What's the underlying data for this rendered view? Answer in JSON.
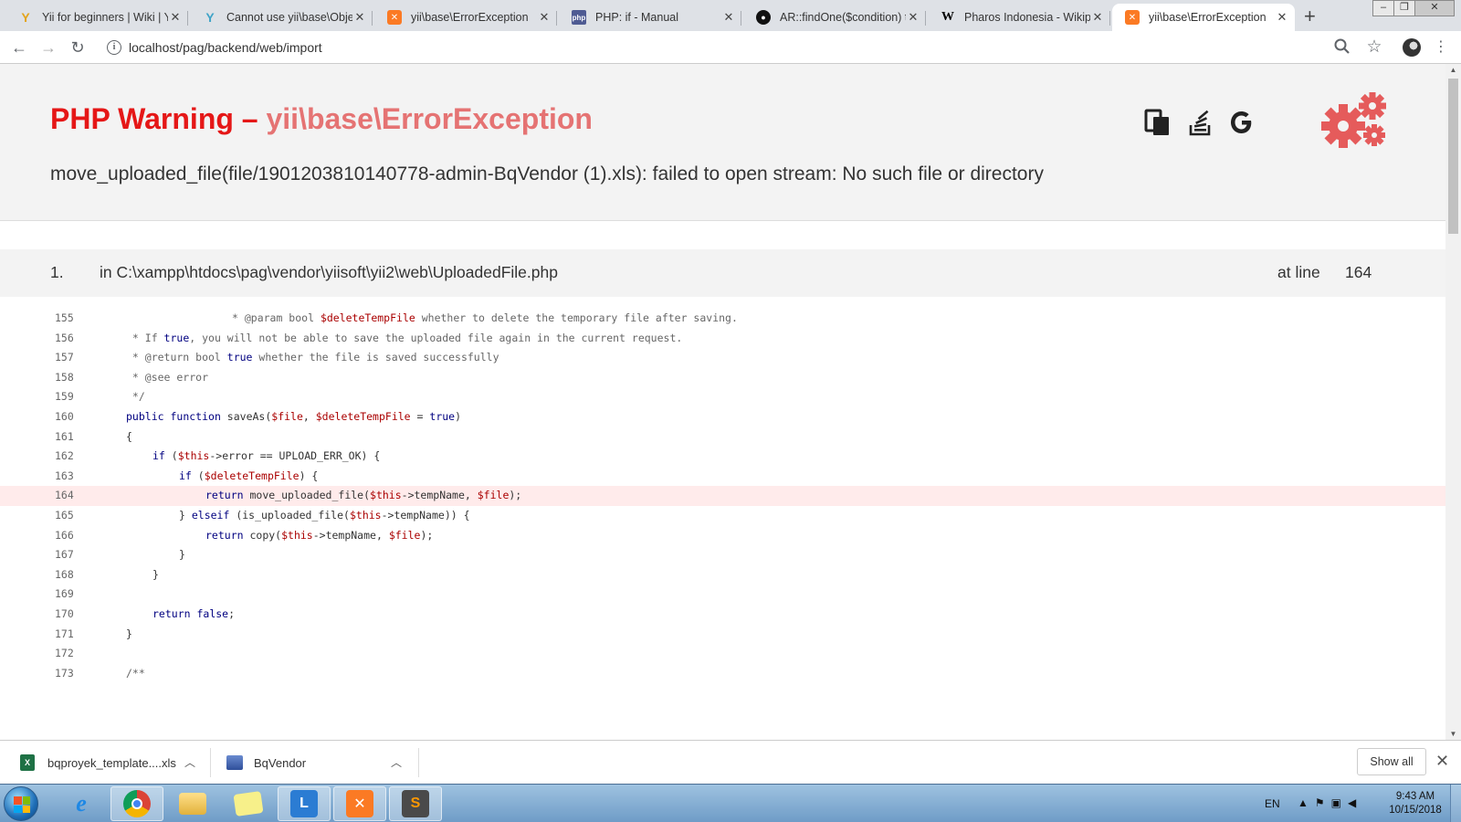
{
  "tabs": [
    {
      "title": "Yii for beginners | Wiki | Yii",
      "icon": "yii-icon",
      "active": false
    },
    {
      "title": "Cannot use yii\\base\\Object",
      "icon": "yii-icon",
      "active": false
    },
    {
      "title": "yii\\base\\ErrorException",
      "icon": "xampp-icon",
      "active": false
    },
    {
      "title": "PHP: if - Manual",
      "icon": "php-icon",
      "active": false
    },
    {
      "title": "AR::findOne($condition) to",
      "icon": "github-icon",
      "active": false
    },
    {
      "title": "Pharos Indonesia - Wikipedia",
      "icon": "wikipedia-icon",
      "active": false
    },
    {
      "title": "yii\\base\\ErrorException",
      "icon": "xampp-icon",
      "active": true
    }
  ],
  "address_bar": {
    "url": "localhost/pag/backend/web/import"
  },
  "error": {
    "type": "PHP Warning",
    "separator": "–",
    "exception": "yii\\base\\ErrorException",
    "message": "move_uploaded_file(file/1901203810140778-admin-BqVendor (1).xls): failed to open stream: No such file or directory"
  },
  "trace": {
    "number": "1.",
    "file": "in C:\\xampp\\htdocs\\pag\\vendor\\yiisoft\\yii2\\web\\UploadedFile.php",
    "at_label": "at line",
    "line": "164"
  },
  "code_lines": [
    {
      "num": "155",
      "indent": 5,
      "text": "* @param bool $deleteTempFile whether to delete the temporary file after saving."
    },
    {
      "num": "156",
      "indent": 1,
      "text": " * If true, you will not be able to save the uploaded file again in the current request."
    },
    {
      "num": "157",
      "indent": 1,
      "text": " * @return bool true whether the file is saved successfully"
    },
    {
      "num": "158",
      "indent": 1,
      "text": " * @see error"
    },
    {
      "num": "159",
      "indent": 1,
      "text": " */"
    },
    {
      "num": "160",
      "indent": 1,
      "text": "public function saveAs($file, $deleteTempFile = true)"
    },
    {
      "num": "161",
      "indent": 1,
      "text": "{"
    },
    {
      "num": "162",
      "indent": 2,
      "text": "if ($this->error == UPLOAD_ERR_OK) {"
    },
    {
      "num": "163",
      "indent": 3,
      "text": "if ($deleteTempFile) {"
    },
    {
      "num": "164",
      "indent": 4,
      "text": "return move_uploaded_file($this->tempName, $file);",
      "highlight": true
    },
    {
      "num": "165",
      "indent": 3,
      "text": "} elseif (is_uploaded_file($this->tempName)) {"
    },
    {
      "num": "166",
      "indent": 4,
      "text": "return copy($this->tempName, $file);"
    },
    {
      "num": "167",
      "indent": 3,
      "text": "}"
    },
    {
      "num": "168",
      "indent": 2,
      "text": "}"
    },
    {
      "num": "169",
      "indent": 0,
      "text": ""
    },
    {
      "num": "170",
      "indent": 2,
      "text": "return false;"
    },
    {
      "num": "171",
      "indent": 1,
      "text": "}"
    },
    {
      "num": "172",
      "indent": 0,
      "text": ""
    },
    {
      "num": "173",
      "indent": 1,
      "text": "/**"
    }
  ],
  "downloads": [
    {
      "name": "bqproyek_template....xls",
      "icon": "excel-file-icon"
    },
    {
      "name": "BqVendor",
      "icon": "app-file-icon"
    }
  ],
  "download_shelf": {
    "show_all_label": "Show all"
  },
  "taskbar": {
    "apps": [
      "internet-explorer-icon",
      "chrome-icon",
      "file-explorer-icon",
      "sticky-notes-icon",
      "lync-icon",
      "xampp-icon",
      "sublime-text-icon"
    ],
    "language": "EN",
    "time": "9:43 AM",
    "date": "10/15/2018"
  },
  "colors": {
    "error_red": "#e51717",
    "exception_pink": "#e57373",
    "highlight_line": "#ffebeb",
    "gear": "#e55b5b"
  }
}
